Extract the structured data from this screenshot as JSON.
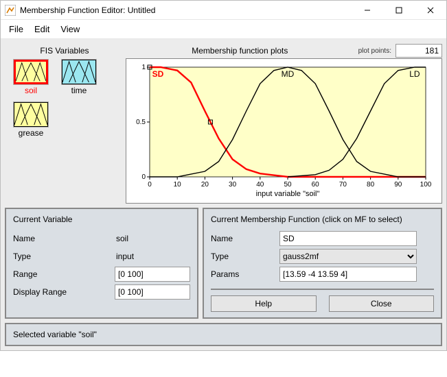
{
  "window": {
    "title": "Membership Function Editor: Untitled"
  },
  "menu": {
    "file": "File",
    "edit": "Edit",
    "view": "View"
  },
  "fis": {
    "title": "FIS Variables",
    "items": [
      {
        "label": "soil",
        "selected": true,
        "kind": "input"
      },
      {
        "label": "time",
        "selected": false,
        "kind": "output"
      },
      {
        "label": "grease",
        "selected": false,
        "kind": "input"
      }
    ]
  },
  "plot": {
    "title": "Membership function plots",
    "points_label": "plot points:",
    "points_value": "181",
    "xaxis_label": "input variable \"soil\"",
    "mf_labels": {
      "sd": "SD",
      "md": "MD",
      "ld": "LD"
    }
  },
  "chart_data": {
    "type": "line",
    "title": "Membership function plots",
    "xlabel": "input variable \"soil\"",
    "ylabel": "",
    "xlim": [
      0,
      100
    ],
    "ylim": [
      0,
      1
    ],
    "xticks": [
      0,
      10,
      20,
      30,
      40,
      50,
      60,
      70,
      80,
      90,
      100
    ],
    "yticks": [
      0,
      0.5,
      1
    ],
    "series": [
      {
        "name": "SD",
        "selected": true,
        "color": "#ff0000",
        "mf_type": "gauss2mf",
        "params": [
          13.59,
          -4,
          13.59,
          4
        ],
        "x": [
          0,
          4,
          10,
          15,
          20,
          25,
          30,
          35,
          40,
          50,
          60,
          70,
          100
        ],
        "values": [
          1.0,
          1.0,
          0.97,
          0.86,
          0.6,
          0.35,
          0.16,
          0.07,
          0.03,
          0.0,
          0.0,
          0.0,
          0.0
        ]
      },
      {
        "name": "MD",
        "selected": false,
        "color": "#000000",
        "x": [
          0,
          10,
          20,
          25,
          30,
          35,
          40,
          45,
          50,
          55,
          60,
          65,
          70,
          75,
          80,
          90,
          100
        ],
        "values": [
          0.0,
          0.0,
          0.05,
          0.14,
          0.34,
          0.6,
          0.85,
          0.97,
          1.0,
          0.97,
          0.85,
          0.6,
          0.34,
          0.14,
          0.05,
          0.0,
          0.0
        ]
      },
      {
        "name": "LD",
        "selected": false,
        "color": "#000000",
        "x": [
          50,
          60,
          65,
          70,
          75,
          80,
          85,
          90,
          96,
          100
        ],
        "values": [
          0.0,
          0.02,
          0.06,
          0.16,
          0.35,
          0.6,
          0.85,
          0.97,
          1.0,
          1.0
        ]
      }
    ]
  },
  "cur_var": {
    "title": "Current Variable",
    "name_label": "Name",
    "name_value": "soil",
    "type_label": "Type",
    "type_value": "input",
    "range_label": "Range",
    "range_value": "[0 100]",
    "drange_label": "Display Range",
    "drange_value": "[0 100]"
  },
  "cur_mf": {
    "title": "Current Membership Function (click on MF to select)",
    "name_label": "Name",
    "name_value": "SD",
    "type_label": "Type",
    "type_value": "gauss2mf",
    "params_label": "Params",
    "params_value": "[13.59 -4 13.59 4]",
    "help": "Help",
    "close": "Close"
  },
  "status": "Selected variable \"soil\""
}
